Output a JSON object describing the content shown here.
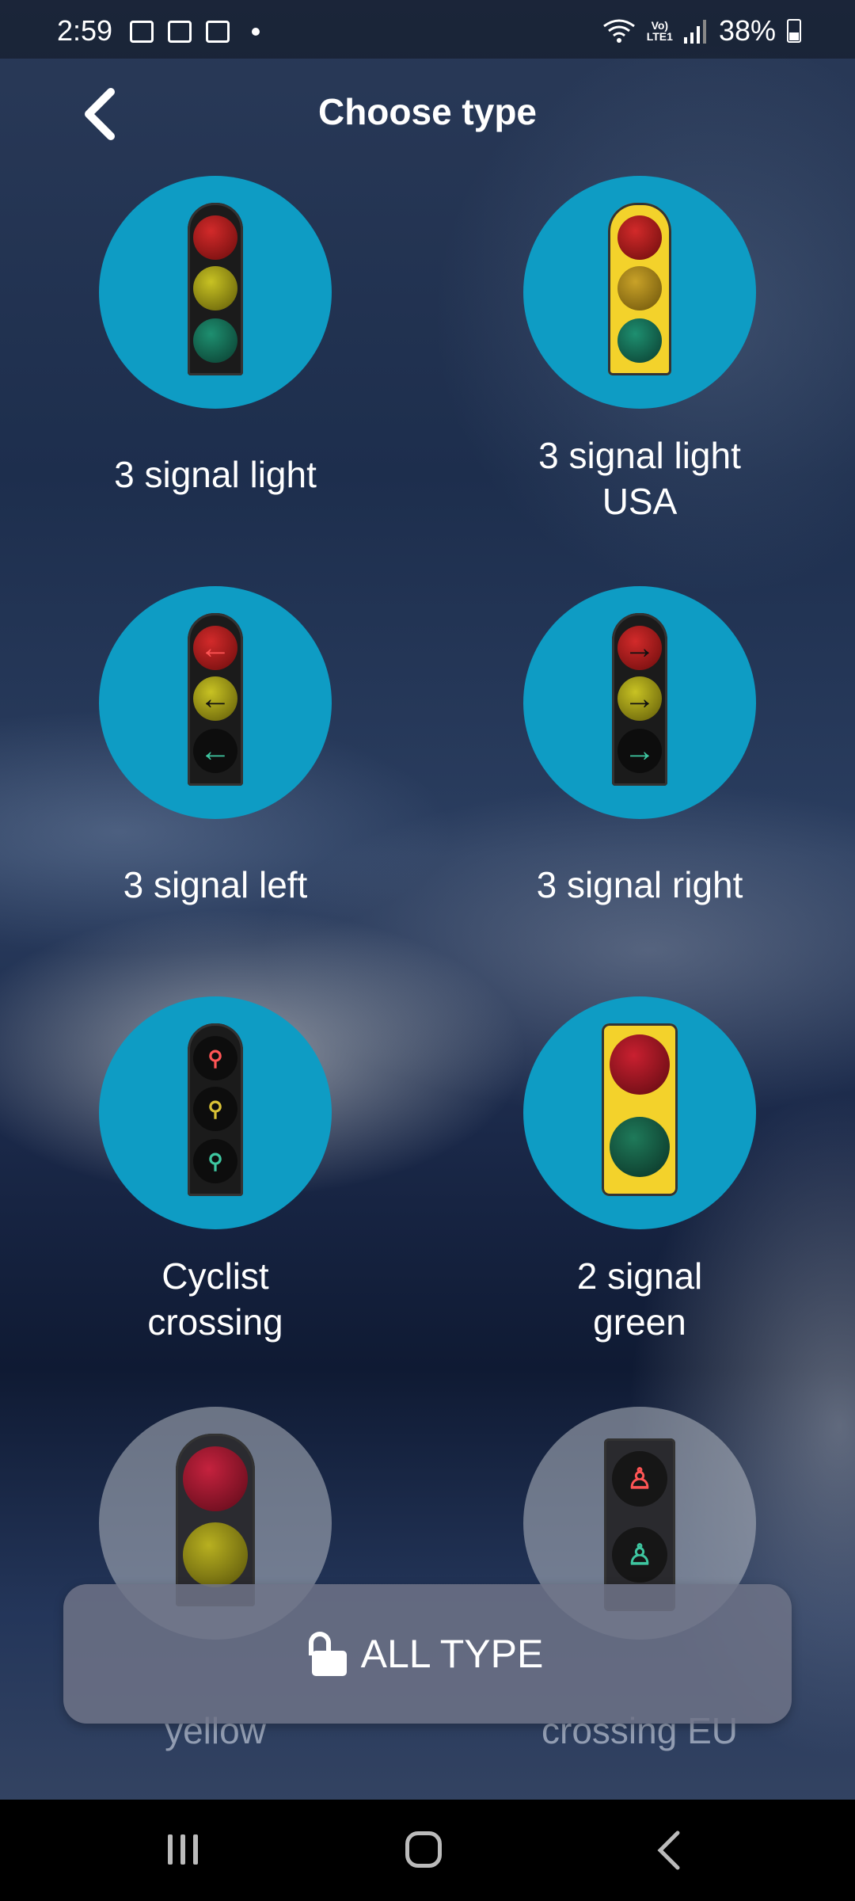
{
  "status_bar": {
    "time": "2:59",
    "carrier_label_top": "Vo)",
    "carrier_label_bottom": "LTE1",
    "battery": "38%"
  },
  "header": {
    "title": "Choose type"
  },
  "items": [
    {
      "label": "3 signal light",
      "icon": "traffic-light-3-icon"
    },
    {
      "label": "3 signal light USA",
      "icon": "traffic-light-usa-icon"
    },
    {
      "label": "3 signal left",
      "icon": "traffic-light-left-arrows-icon"
    },
    {
      "label": "3 signal right",
      "icon": "traffic-light-right-arrows-icon"
    },
    {
      "label": "Cyclist crossing",
      "icon": "cyclist-traffic-light-icon"
    },
    {
      "label": "2 signal green",
      "icon": "traffic-light-2-icon"
    }
  ],
  "faded_labels": {
    "left": "yellow",
    "right": "crossing EU"
  },
  "unlock_button": {
    "label": "ALL TYPE",
    "icon": "unlock-icon"
  },
  "colors": {
    "circle": "#0e9cc4",
    "button": "#6e7387"
  }
}
